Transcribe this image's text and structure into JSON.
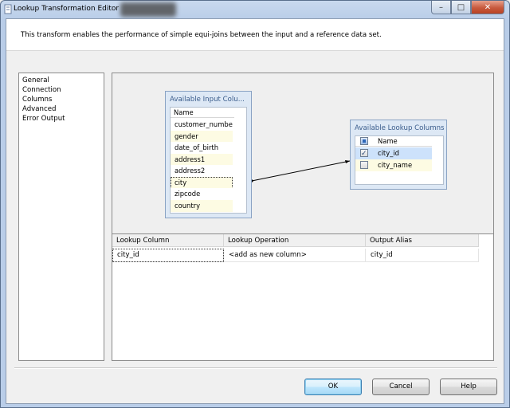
{
  "window": {
    "title": "Lookup Transformation Editor"
  },
  "description": "This transform enables the performance of simple equi-joins between the input and a reference data set.",
  "nav": {
    "items": [
      "General",
      "Connection",
      "Columns",
      "Advanced",
      "Error Output"
    ],
    "selected": "Columns"
  },
  "input_columns": {
    "title": "Available Input Colu...",
    "header": "Name",
    "rows": [
      "customer_number",
      "gender",
      "date_of_birth",
      "address1",
      "address2",
      "city",
      "zipcode",
      "country"
    ]
  },
  "lookup_columns": {
    "title": "Available Lookup Columns",
    "header": "Name",
    "rows": [
      {
        "name": "city_id",
        "checked": true
      },
      {
        "name": "city_name",
        "checked": false
      }
    ]
  },
  "join": {
    "from": "city",
    "to": "city_id"
  },
  "grid": {
    "headers": [
      "Lookup Column",
      "Lookup Operation",
      "Output Alias"
    ],
    "rows": [
      {
        "lookup_column": "city_id",
        "lookup_operation": "<add as new column>",
        "output_alias": "city_id"
      }
    ]
  },
  "buttons": {
    "ok": "OK",
    "cancel": "Cancel",
    "help": "Help"
  },
  "colors": {
    "accent": "#3b5d8c",
    "selection": "#cde2fb",
    "shaded_row": "#fdfbe3",
    "close_button": "#c85a3e"
  }
}
